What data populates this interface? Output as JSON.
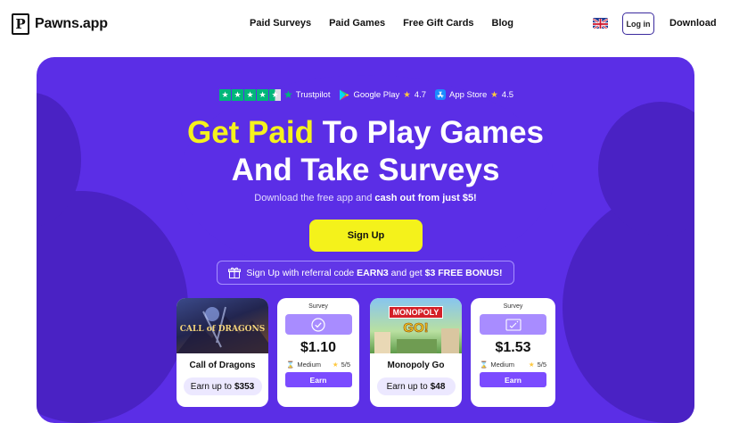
{
  "brand": {
    "name": "Pawns.app",
    "mark": "P"
  },
  "nav": {
    "items": [
      "Paid Surveys",
      "Paid Games",
      "Free Gift Cards",
      "Blog"
    ],
    "login": "Log in",
    "download": "Download"
  },
  "ratings": {
    "trustpilot": "Trustpilot",
    "google_play": "Google Play",
    "google_play_rating": "4.7",
    "app_store": "App Store",
    "app_store_rating": "4.5"
  },
  "hero": {
    "headline_accent": "Get Paid",
    "headline_rest": " To Play Games",
    "headline_line2": "And Take Surveys",
    "sub_prefix": "Download the free app and ",
    "sub_bold": "cash out from just $5!",
    "signup": "Sign Up",
    "referral_prefix": "Sign Up with referral code ",
    "referral_code": "EARN3",
    "referral_mid": " and get ",
    "referral_bonus": "$3 FREE BONUS!"
  },
  "cards": [
    {
      "type": "game",
      "title": "Call of Dragons",
      "art_text": "CALL of DRAGONS",
      "earn_prefix": "Earn up to",
      "earn_value": "$353"
    },
    {
      "type": "survey",
      "label": "Survey",
      "amount": "$1.10",
      "difficulty": "Medium",
      "rating": "5/5",
      "button": "Earn"
    },
    {
      "type": "game",
      "title": "Monopoly Go",
      "art_text_1": "MONOPOLY",
      "art_text_2": "GO!",
      "earn_prefix": "Earn up to",
      "earn_value": "$48"
    },
    {
      "type": "survey",
      "label": "Survey",
      "amount": "$1.53",
      "difficulty": "Medium",
      "rating": "5/5",
      "button": "Earn"
    }
  ],
  "colors": {
    "hero_bg": "#5b2ee6",
    "accent_yellow": "#f4f21b",
    "button_purple": "#7b4bff",
    "trustpilot_green": "#00b67a"
  }
}
